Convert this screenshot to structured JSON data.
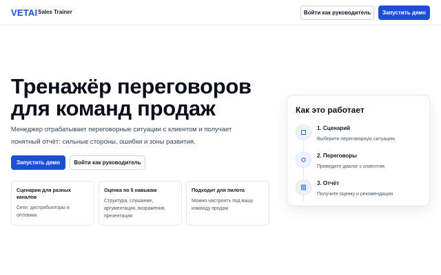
{
  "header": {
    "logo": "VETAI",
    "subtitle": "Sales Trainer",
    "manager_login_label": "Войти как руководитель",
    "start_demo_label": "Запустить демо"
  },
  "hero": {
    "title_line1": "Тренажёр переговоров",
    "title_line2": "для команд продаж",
    "subtitle_line1": "Менеджер отрабатывает переговорные ситуации с клиентом и получает",
    "subtitle_line2": "понятный отчёт: сильные стороны, ошибки и зоны развития.",
    "start_demo_label": "Запустить демо",
    "manager_login_label": "Войти как руководитель"
  },
  "features": [
    {
      "title": "Сценарии для разных каналов",
      "text": "Сети, дистрибьюторы и оптовики"
    },
    {
      "title": "Оценка по 5 навыкам",
      "text": "Структура, слушание, аргументация, возражения, презентация"
    },
    {
      "title": "Подходит для пилота",
      "text": "Можно настроить под вашу команду продаж"
    }
  ],
  "how_it_works": {
    "title": "Как это работает",
    "steps": [
      {
        "title": "1. Сценарий",
        "text": "Выберите переговорную ситуацию",
        "icon": "square-icon"
      },
      {
        "title": "2. Переговоры",
        "text": "Проведите диалог с клиентом",
        "icon": "circle-icon"
      },
      {
        "title": "3. Отчёт",
        "text": "Получите оценку и рекомендации",
        "icon": "document-icon"
      }
    ]
  },
  "colors": {
    "accent": "#1d4ed8",
    "icon_bg": "#eef3ff",
    "border": "#e5e7eb",
    "text": "#0f172a"
  }
}
